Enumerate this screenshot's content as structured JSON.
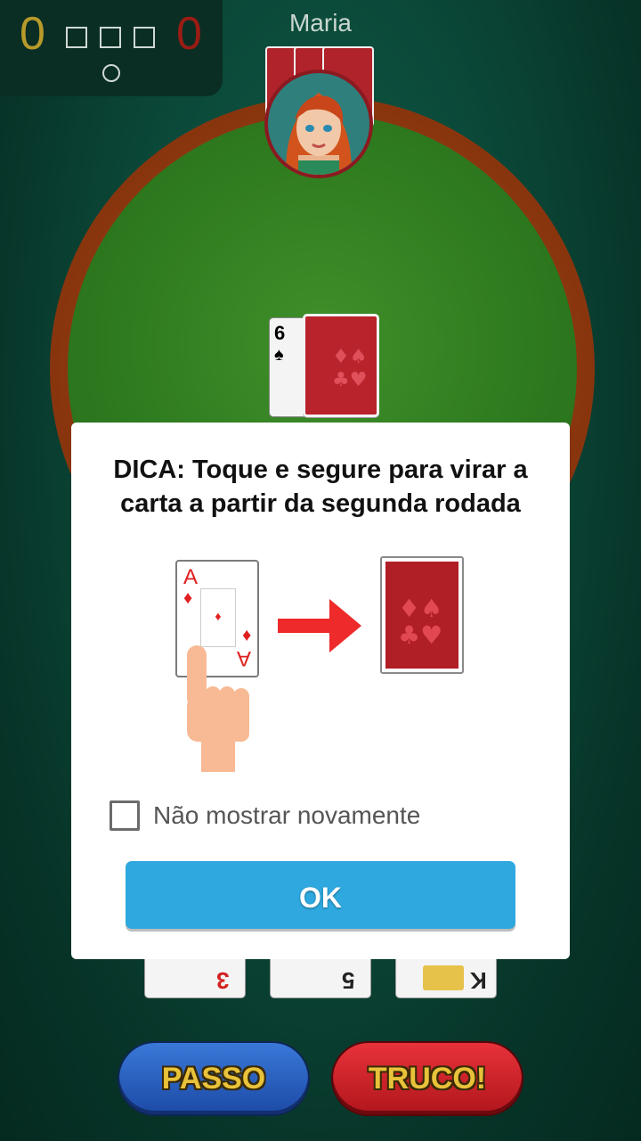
{
  "score": {
    "team_left": "0",
    "team_right": "0"
  },
  "opponent": {
    "name": "Maria"
  },
  "table": {
    "visible_card": {
      "rank": "6",
      "suit": "♠"
    }
  },
  "dialog": {
    "title": "DICA: Toque e segure para virar a carta a partir da segunda rodada",
    "hint_card": {
      "rank": "A",
      "suit": "♦"
    },
    "checkbox_label": "Não mostrar novamente",
    "ok_label": "OK"
  },
  "hand": [
    {
      "rank": "3",
      "color": "#d42020"
    },
    {
      "rank": "5",
      "color": "#222222"
    },
    {
      "rank": "K",
      "color": "#222222"
    }
  ],
  "buttons": {
    "passo": "PASSO",
    "truco": "TRUCO!"
  },
  "colors": {
    "score_left": "#b89a2a",
    "score_right": "#9a1c14",
    "ok_button": "#2ea8df",
    "card_back": "#b8232c"
  }
}
